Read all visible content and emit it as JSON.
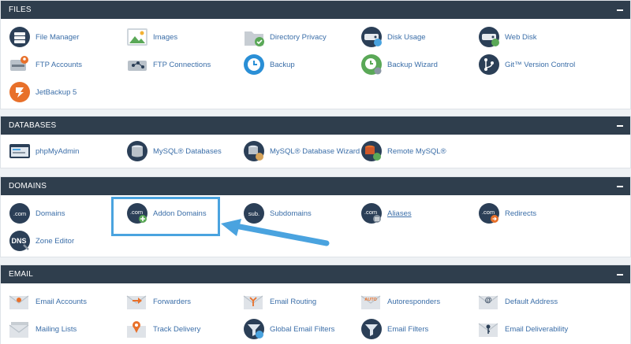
{
  "sections": {
    "files": {
      "title": "FILES",
      "items": [
        "File Manager",
        "Images",
        "Directory Privacy",
        "Disk Usage",
        "Web Disk",
        "FTP Accounts",
        "FTP Connections",
        "Backup",
        "Backup Wizard",
        "Git™ Version Control",
        "JetBackup 5"
      ]
    },
    "databases": {
      "title": "DATABASES",
      "items": [
        "phpMyAdmin",
        "MySQL® Databases",
        "MySQL® Database Wizard",
        "Remote MySQL®"
      ]
    },
    "domains": {
      "title": "DOMAINS",
      "items": [
        "Domains",
        "Addon Domains",
        "Subdomains",
        "Aliases",
        "Redirects",
        "Zone Editor"
      ],
      "icon_text": {
        "com": ".com",
        "sub": "sub.",
        "dns": "DNS"
      }
    },
    "email": {
      "title": "EMAIL",
      "items": [
        "Email Accounts",
        "Forwarders",
        "Email Routing",
        "Autoresponders",
        "Default Address",
        "Mailing Lists",
        "Track Delivery",
        "Global Email Filters",
        "Email Filters",
        "Email Deliverability"
      ],
      "icon_text": {
        "auto": "AUTO",
        "at": "@"
      }
    }
  },
  "colors": {
    "header_bg": "#2f3e4d",
    "link": "#3b6ea8",
    "highlight": "#4aa3df",
    "icon_dark": "#2b3f57"
  }
}
